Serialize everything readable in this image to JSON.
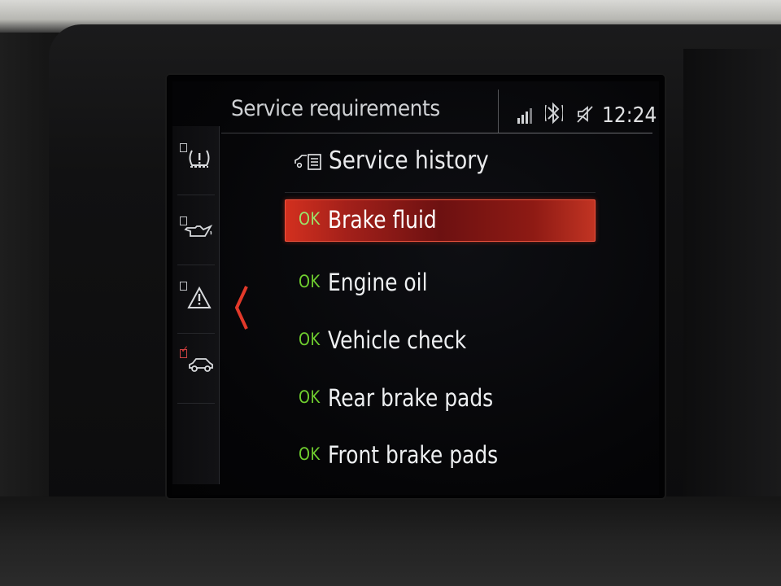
{
  "header": {
    "title": "Service requirements",
    "time": "12:24"
  },
  "status_icons": [
    "signal-icon",
    "bluetooth-icon",
    "mute-icon"
  ],
  "sidebar": {
    "items": [
      {
        "icon": "tire-pressure-icon",
        "checked": false
      },
      {
        "icon": "oil-can-icon",
        "checked": false
      },
      {
        "icon": "warning-triangle-icon",
        "checked": false
      },
      {
        "icon": "car-service-icon",
        "checked": true
      }
    ]
  },
  "menu": {
    "history_label": "Service history",
    "items": [
      {
        "status": "OK",
        "label": "Brake fluid",
        "selected": true
      },
      {
        "status": "OK",
        "label": "Engine oil",
        "selected": false
      },
      {
        "status": "OK",
        "label": "Vehicle check",
        "selected": false
      },
      {
        "status": "OK",
        "label": "Rear brake pads",
        "selected": false
      },
      {
        "status": "OK",
        "label": "Front brake pads",
        "selected": false
      }
    ]
  },
  "colors": {
    "ok_green": "#6fce2f",
    "selection_red": "#c23423",
    "text": "#eef0f2"
  }
}
